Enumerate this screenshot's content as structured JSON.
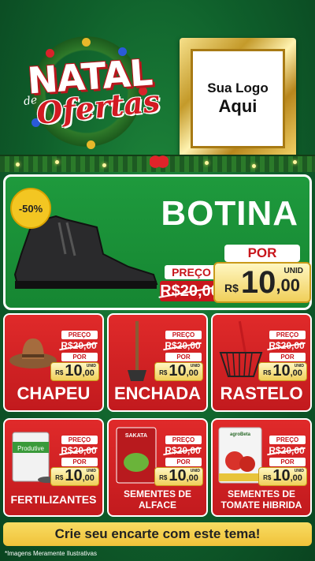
{
  "header": {
    "logo_word1": "NATAL",
    "logo_word2": "de",
    "logo_word3": "Ofertas",
    "frame_line1": "Sua Logo",
    "frame_line2": "Aqui"
  },
  "hero": {
    "discount": "-50%",
    "title": "BOTINA",
    "preco_label": "PREÇO",
    "old_price": "R$20,00",
    "por_label": "POR",
    "currency": "R$",
    "price_int": "10",
    "price_dec": ",00",
    "unit": "UNID"
  },
  "products": [
    {
      "name": "CHAPEU",
      "preco_label": "PREÇO",
      "old_price": "R$20,00",
      "por_label": "POR",
      "currency": "R$",
      "price_int": "10",
      "price_dec": ",00",
      "unit": "UNID"
    },
    {
      "name": "ENCHADA",
      "preco_label": "PREÇO",
      "old_price": "R$20,00",
      "por_label": "POR",
      "currency": "R$",
      "price_int": "10",
      "price_dec": ",00",
      "unit": "UNID"
    },
    {
      "name": "RASTELO",
      "preco_label": "PREÇO",
      "old_price": "R$20,00",
      "por_label": "POR",
      "currency": "R$",
      "price_int": "10",
      "price_dec": ",00",
      "unit": "UNID"
    },
    {
      "name": "FERTILIZANTES",
      "preco_label": "PREÇO",
      "old_price": "R$20,00",
      "por_label": "POR",
      "currency": "R$",
      "price_int": "10",
      "price_dec": ",00",
      "unit": "UNID",
      "package_text": "Produtive"
    },
    {
      "name": "SEMENTES DE ALFACE",
      "preco_label": "PREÇO",
      "old_price": "R$20,00",
      "por_label": "POR",
      "currency": "R$",
      "price_int": "10",
      "price_dec": ",00",
      "unit": "UNID",
      "package_text": "SAKATA"
    },
    {
      "name": "SEMENTES DE TOMATE HIBRIDA",
      "preco_label": "PREÇO",
      "old_price": "R$20,00",
      "por_label": "POR",
      "currency": "R$",
      "price_int": "10",
      "price_dec": ",00",
      "unit": "UNID",
      "package_text": "agroBeta"
    }
  ],
  "cta": "Crie seu encarte com este tema!",
  "footnote": "*Imagens Meramente Ilustrativas",
  "colors": {
    "background_green": "#1e9a3d",
    "card_red": "#d8222a",
    "gold": "#f0c23a",
    "logo_red": "#d21a22"
  }
}
